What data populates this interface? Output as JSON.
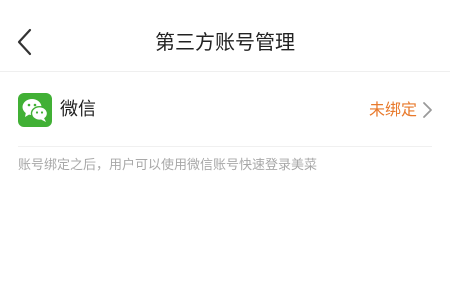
{
  "header": {
    "title": "第三方账号管理",
    "back_icon": "chevron-left-icon"
  },
  "accounts": [
    {
      "icon": "wechat-icon",
      "name": "微信",
      "status": "未绑定",
      "status_color": "#e8792b",
      "brand_color": "#41b035"
    }
  ],
  "hint": "账号绑定之后，用户可以使用微信账号快速登录美菜"
}
